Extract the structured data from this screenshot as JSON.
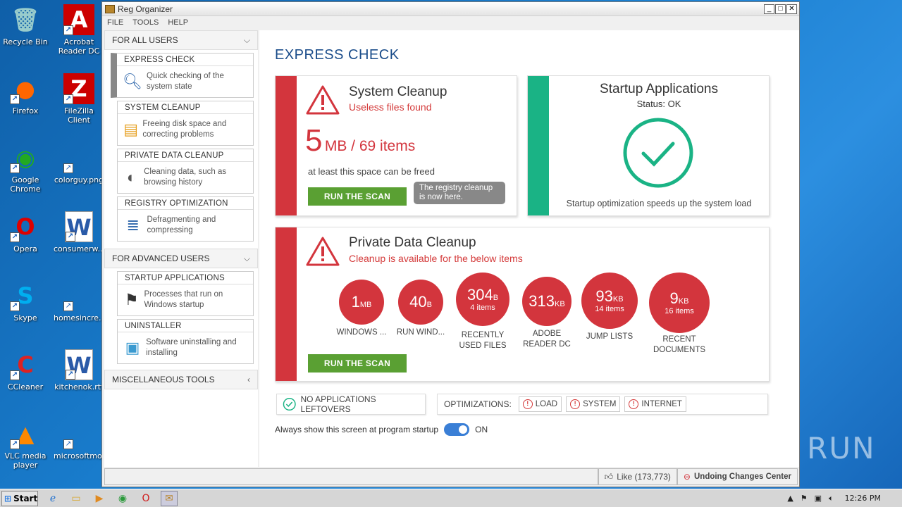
{
  "desktop": {
    "icons": [
      {
        "label": "Recycle Bin",
        "icon": "recycle-bin-icon"
      },
      {
        "label": "Acrobat Reader DC",
        "icon": "acrobat-icon"
      },
      {
        "label": "Firefox",
        "icon": "firefox-icon"
      },
      {
        "label": "FileZilla Client",
        "icon": "filezilla-icon"
      },
      {
        "label": "Google Chrome",
        "icon": "chrome-icon"
      },
      {
        "label": "colorguy.png",
        "icon": "image-file-icon"
      },
      {
        "label": "Opera",
        "icon": "opera-icon"
      },
      {
        "label": "consumerw...",
        "icon": "word-doc-icon"
      },
      {
        "label": "Skype",
        "icon": "skype-icon"
      },
      {
        "label": "homesincre...",
        "icon": "file-icon"
      },
      {
        "label": "CCleaner",
        "icon": "ccleaner-icon"
      },
      {
        "label": "kitchenok.rtf",
        "icon": "word-doc-icon"
      },
      {
        "label": "VLC media player",
        "icon": "vlc-icon"
      },
      {
        "label": "microsoftmo...",
        "icon": "file-icon"
      }
    ],
    "watermark": "ANY RUN"
  },
  "window": {
    "title": "Reg Organizer",
    "controls": {
      "minimize": "_",
      "maximize": "□",
      "close": "✕"
    },
    "menu": [
      "FILE",
      "TOOLS",
      "HELP"
    ]
  },
  "sidebar": {
    "for_all_users": "FOR ALL USERS",
    "cards_all": [
      {
        "title": "EXPRESS CHECK",
        "desc": "Quick checking of the system state",
        "icon": "magnifier-icon"
      },
      {
        "title": "SYSTEM CLEANUP",
        "desc": "Freeing disk space and correcting problems",
        "icon": "broom-icon"
      },
      {
        "title": "PRIVATE DATA CLEANUP",
        "desc": "Cleaning data, such as browsing history",
        "icon": "privacy-icon"
      },
      {
        "title": "REGISTRY OPTIMIZATION",
        "desc": "Defragmenting and compressing",
        "icon": "registry-icon"
      }
    ],
    "for_advanced_users": "FOR ADVANCED USERS",
    "cards_adv": [
      {
        "title": "STARTUP APPLICATIONS",
        "desc": "Processes that run on Windows startup",
        "icon": "startup-flag-icon"
      },
      {
        "title": "UNINSTALLER",
        "desc": "Software uninstalling and installing",
        "icon": "uninstaller-box-icon"
      }
    ],
    "misc": "MISCELLANEOUS TOOLS"
  },
  "main": {
    "heading": "EXPRESS CHECK",
    "system_cleanup": {
      "title": "System Cleanup",
      "subtitle": "Useless files found",
      "big_num": "5",
      "big_unit": "MB / 69 items",
      "caption": "at least this space can be freed",
      "button": "RUN THE SCAN",
      "tooltip": "The registry cleanup is now here."
    },
    "startup": {
      "title": "Startup Applications",
      "status": "Status: OK",
      "caption": "Startup optimization speeds up the system load"
    },
    "private": {
      "title": "Private Data Cleanup",
      "subtitle": "Cleanup is available for the below items",
      "button": "RUN THE SCAN",
      "items": [
        {
          "value": "1",
          "unit": "MB",
          "sub": "",
          "label": "WINDOWS ..."
        },
        {
          "value": "40",
          "unit": "B",
          "sub": "",
          "label": "RUN WIND..."
        },
        {
          "value": "304",
          "unit": "B",
          "sub": "4 items",
          "label": "RECENTLY USED FILES"
        },
        {
          "value": "313",
          "unit": "KB",
          "sub": "",
          "label": "ADOBE READER DC"
        },
        {
          "value": "93",
          "unit": "KB",
          "sub": "14 items",
          "label": "JUMP LISTS"
        },
        {
          "value": "9",
          "unit": "KB",
          "sub": "16 items",
          "label": "RECENT DOCUMENTS"
        }
      ]
    },
    "leftovers": "NO APPLICATIONS LEFTOVERS",
    "optimizations_label": "OPTIMIZATIONS:",
    "optimizations": [
      "LOAD",
      "SYSTEM",
      "INTERNET"
    ],
    "always_show": "Always show this screen at program startup",
    "toggle_state": "ON"
  },
  "statusbar": {
    "like": "Like (173,773)",
    "undo": "Undoing Changes Center"
  },
  "taskbar": {
    "start": "Start",
    "time": "12:26 PM"
  },
  "colors": {
    "red": "#d3353d",
    "green": "#5aa033",
    "teal": "#1ab385",
    "blue": "#1a4c8a"
  }
}
